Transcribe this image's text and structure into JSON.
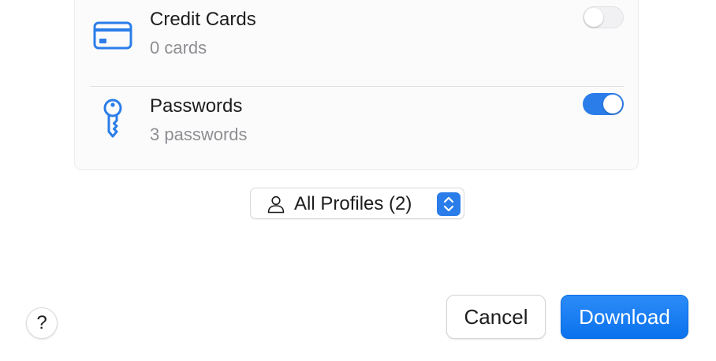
{
  "colors": {
    "accent": "#2b7de9",
    "primary_button": "#0a72ee",
    "secondary_text": "#8e8e93"
  },
  "items": [
    {
      "icon": "credit-card-icon",
      "title": "Credit Cards",
      "subtitle": "0 cards",
      "enabled": false
    },
    {
      "icon": "key-icon",
      "title": "Passwords",
      "subtitle": "3 passwords",
      "enabled": true
    }
  ],
  "profile_selector": {
    "icon": "person-icon",
    "label": "All Profiles (2)"
  },
  "help": {
    "icon": "question-mark-icon",
    "label": "?"
  },
  "actions": {
    "cancel_label": "Cancel",
    "download_label": "Download"
  }
}
